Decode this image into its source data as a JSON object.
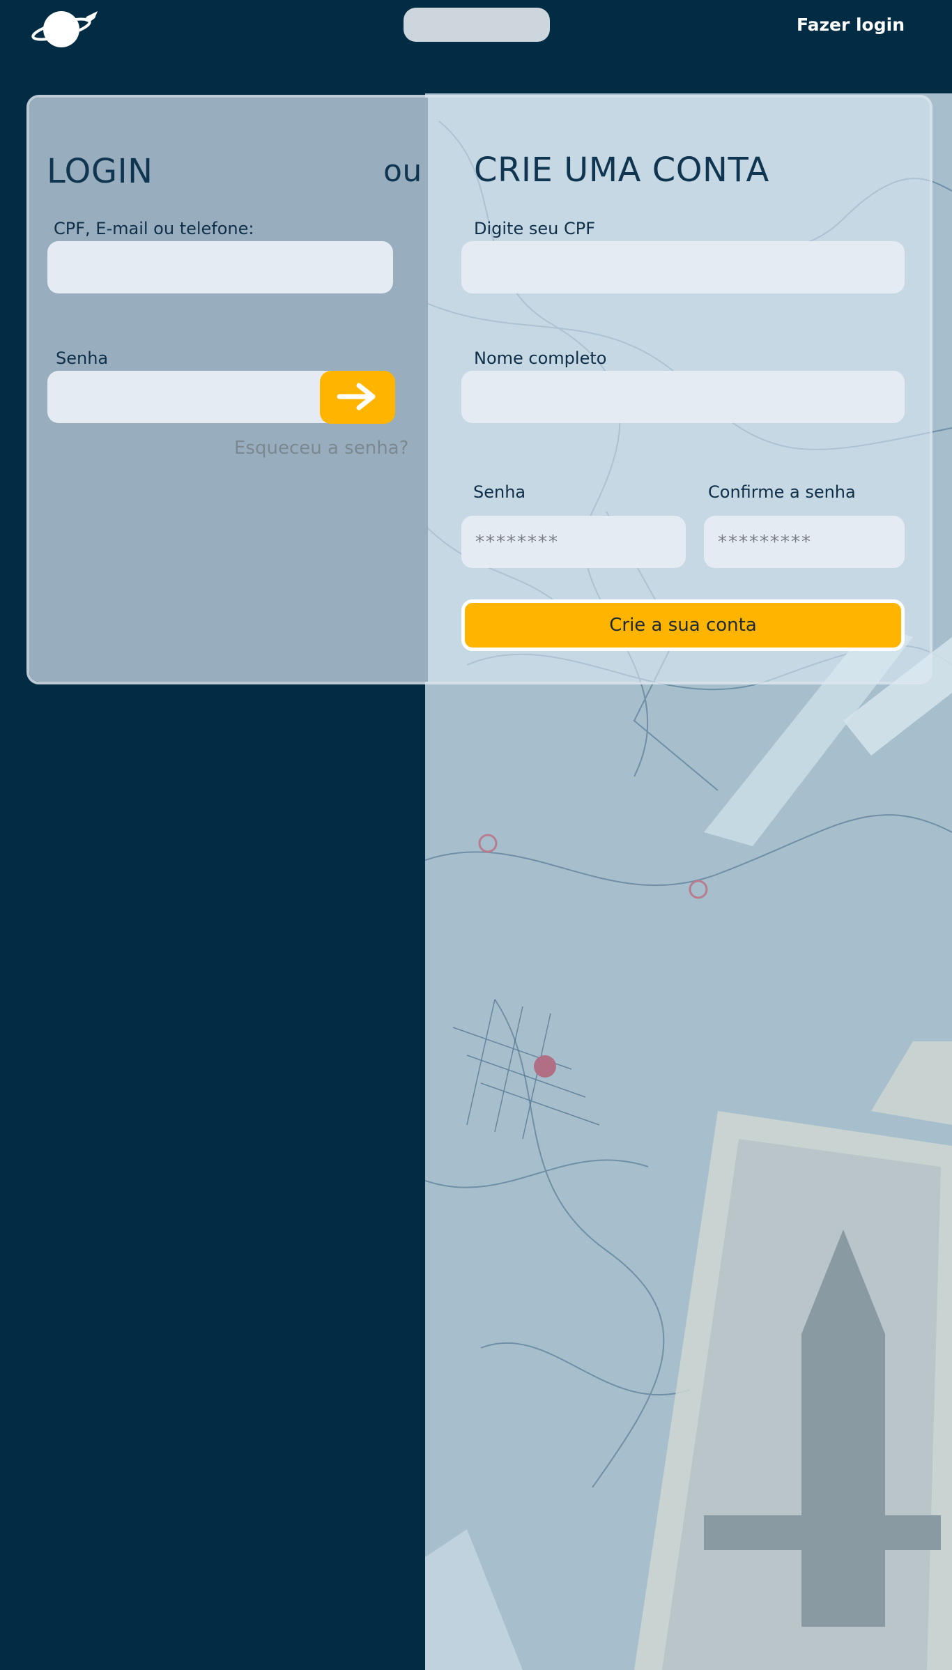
{
  "header": {
    "logo_icon": "planet-plane-icon",
    "login_link": "Fazer login"
  },
  "login": {
    "title": "LOGIN",
    "user_label": "CPF, E-mail ou telefone:",
    "password_label": "Senha",
    "submit_icon": "arrow-right-icon",
    "forgot_link": "Esqueceu a senha?"
  },
  "divider_text": "ou",
  "signup": {
    "title": "CRIE UMA CONTA",
    "cpf_label": "Digite seu CPF",
    "name_label": "Nome completo",
    "password_label": "Senha",
    "password_placeholder": "********",
    "confirm_label": "Confirme a senha",
    "confirm_placeholder": "*********",
    "submit_label": "Crie a sua conta"
  },
  "colors": {
    "background": "#022c43",
    "accent": "#ffb400",
    "card_left": "#98aebf",
    "title_text": "#0f3550"
  }
}
